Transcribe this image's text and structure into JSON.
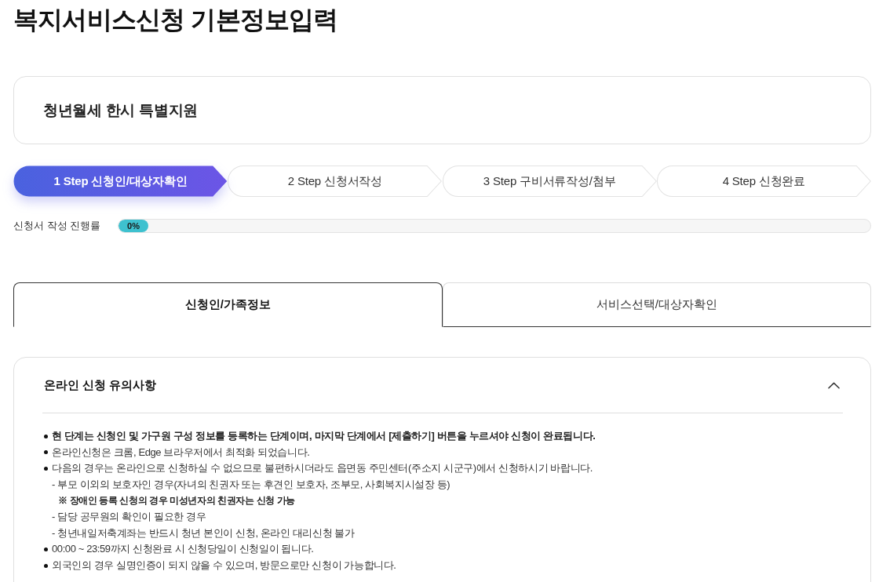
{
  "page_title": "복지서비스신청 기본정보입력",
  "service": {
    "name": "청년월세 한시 특별지원"
  },
  "steps": [
    {
      "label": "1 Step 신청인/대상자확인",
      "selected": true
    },
    {
      "label": "2 Step 신청서작성",
      "selected": false
    },
    {
      "label": "3 Step 구비서류작성/첨부",
      "selected": false
    },
    {
      "label": "4 Step 신청완료",
      "selected": false
    }
  ],
  "progress": {
    "label": "신청서 작성 진행률",
    "level": 0,
    "reading": "0%"
  },
  "tabs": [
    {
      "label": "신청인/가족정보",
      "selected": true
    },
    {
      "label": "서비스선택/대상자확인",
      "selected": false
    }
  ],
  "notice": {
    "title": "온라인 신청 유의사항",
    "expanded": true,
    "items": [
      {
        "kind": "bullet",
        "bold": true,
        "text": "현 단계는 신청인 및 가구원 구성 정보를 등록하는 단계이며, 마지막 단계에서 [제출하기] 버튼을 누르셔야 신청이 완료됩니다."
      },
      {
        "kind": "bullet",
        "bold": false,
        "text": "온라인신청은 크롬, Edge 브라우저에서 최적화 되었습니다."
      },
      {
        "kind": "bullet",
        "bold": false,
        "text": "다음의 경우는 온라인으로 신청하실 수 없으므로 불편하시더라도 읍면동 주민센터(주소지 시군구)에서 신청하시기 바랍니다.",
        "children": [
          {
            "kind": "dash",
            "bold": false,
            "text": "- 부모 이외의 보호자인 경우(자녀의 친권자 또는 후견인 보호자, 조부모, 사회복지시설장 등)",
            "children": [
              {
                "kind": "note",
                "bold": true,
                "text": "※ 장애인 등록 신청의 경우 미성년자의 친권자는 신청 가능"
              }
            ]
          },
          {
            "kind": "dash",
            "bold": false,
            "text": "- 담당 공무원의 확인이 필요한 경우"
          },
          {
            "kind": "dash",
            "bold": false,
            "text": "- 청년내일저축계좌는 반드시 청년 본인이 신청, 온라인 대리신청 불가"
          }
        ]
      },
      {
        "kind": "bullet",
        "bold": false,
        "text": "00:00 ~ 23:59까지 신청완료 시 신청당일이 신청일이 됩니다."
      },
      {
        "kind": "bullet",
        "bold": false,
        "text": "외국인의 경우 실명인증이 되지 않을 수 있으며, 방문으로만 신청이 가능합니다."
      }
    ]
  }
}
